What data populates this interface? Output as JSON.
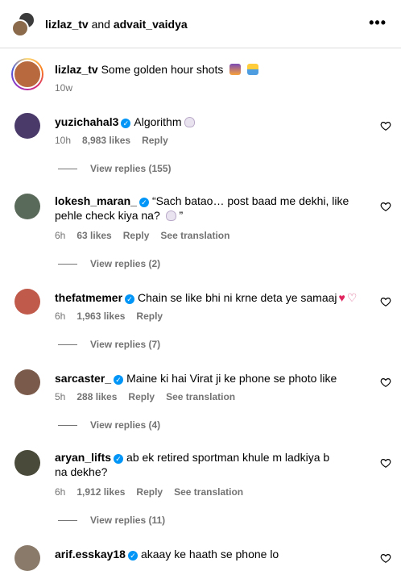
{
  "header": {
    "user1": "lizlaz_tv",
    "joiner": "and",
    "user2": "advait_vaidya",
    "more_icon": "•••"
  },
  "caption": {
    "username": "lizlaz_tv",
    "text": "Some golden hour shots",
    "emojis": [
      "sunset-emoji",
      "sunrise-emoji"
    ],
    "time": "10w"
  },
  "comments": [
    {
      "username": "yuzichahal3",
      "verified": true,
      "text": "Algorithm",
      "time": "10h",
      "likes": "8,983 likes",
      "reply": "Reply",
      "translation": "",
      "view_replies": "View replies (155)",
      "avatar_color": "#4a3a6a"
    },
    {
      "username": "lokesh_maran_",
      "verified": true,
      "text": "“Sach batao… post baad me dekhi, like pehle check kiya na? ",
      "text_end": " ”",
      "time": "6h",
      "likes": "63 likes",
      "reply": "Reply",
      "translation": "See translation",
      "view_replies": "View replies (2)",
      "avatar_color": "#5a6a5a"
    },
    {
      "username": "thefatmemer",
      "verified": true,
      "text": "Chain se like bhi ni krne deta ye samaaj",
      "time": "6h",
      "likes": "1,963 likes",
      "reply": "Reply",
      "translation": "",
      "view_replies": "View replies (7)",
      "avatar_color": "#c05a4a"
    },
    {
      "username": "sarcaster_",
      "verified": true,
      "text": "Maine ki hai Virat ji ke phone se photo like",
      "time": "5h",
      "likes": "288 likes",
      "reply": "Reply",
      "translation": "See translation",
      "view_replies": "View replies (4)",
      "avatar_color": "#7a5a4a"
    },
    {
      "username": "aryan_lifts",
      "verified": true,
      "text": "ab ek retired sportman khule m ladkiya b na dekhe?",
      "time": "6h",
      "likes": "1,912 likes",
      "reply": "Reply",
      "translation": "See translation",
      "view_replies": "View replies (11)",
      "avatar_color": "#4a4a3a"
    },
    {
      "username": "arif.esskay18",
      "verified": true,
      "text": "akaay ke haath se phone lo",
      "time": "",
      "likes": "",
      "reply": "",
      "translation": "",
      "view_replies": "",
      "avatar_color": "#8a7a6a"
    }
  ],
  "colors": {
    "verified": "#0095f6",
    "secondary_text": "#737373",
    "divider": "#dbdbdb"
  }
}
